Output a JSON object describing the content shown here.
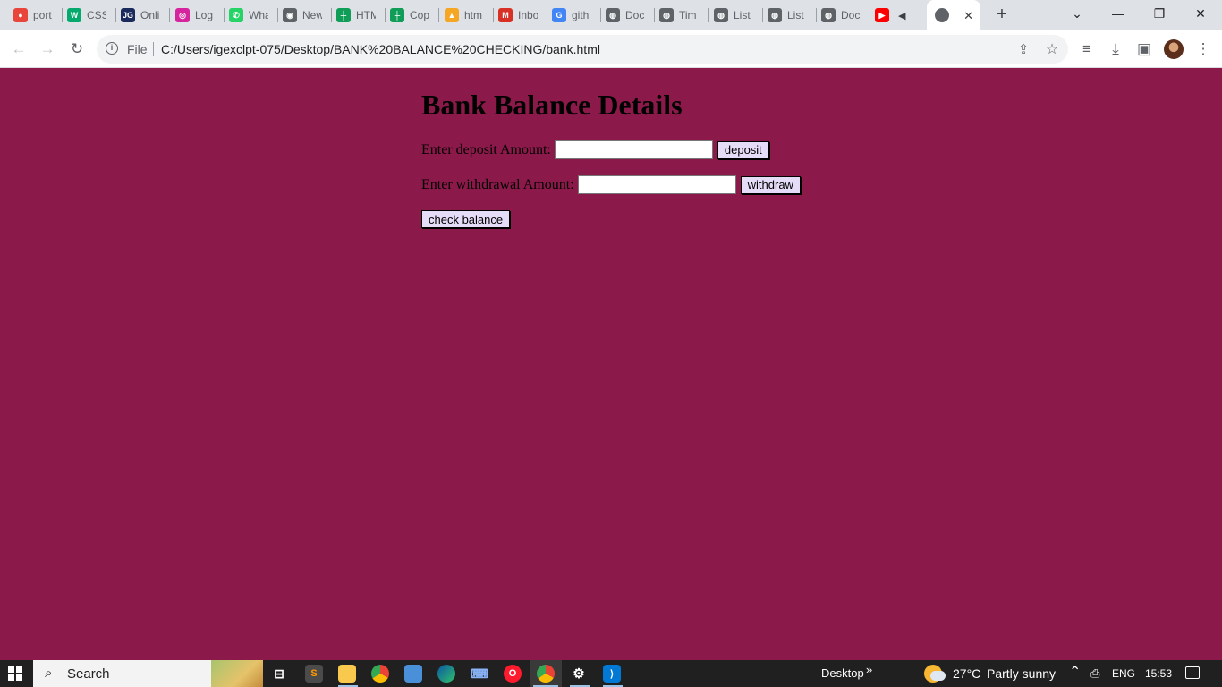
{
  "browser": {
    "tabs": [
      {
        "label": "port",
        "icon": "pdf-icon",
        "color": "#e8453c",
        "glyph": "●"
      },
      {
        "label": "CSS",
        "icon": "w3schools-icon",
        "color": "#04aa6d",
        "glyph": "W"
      },
      {
        "label": "Onli",
        "icon": "jgi-icon",
        "color": "#1b2a5c",
        "glyph": "JG"
      },
      {
        "label": "Log",
        "icon": "instagram-icon",
        "color": "#d6249f",
        "glyph": "◎"
      },
      {
        "label": "Wha",
        "icon": "whatsapp-icon",
        "color": "#25d366",
        "glyph": "✆"
      },
      {
        "label": "New",
        "icon": "chrome-icon",
        "color": "#5f6368",
        "glyph": "◉"
      },
      {
        "label": "HTM",
        "icon": "sheets-icon",
        "color": "#0f9d58",
        "glyph": "┼"
      },
      {
        "label": "Cop",
        "icon": "sheets-icon",
        "color": "#0f9d58",
        "glyph": "┼"
      },
      {
        "label": "htm",
        "icon": "chart-icon",
        "color": "#f5a623",
        "glyph": "▲"
      },
      {
        "label": "Inbo",
        "icon": "gmail-icon",
        "color": "#d93025",
        "glyph": "M"
      },
      {
        "label": "gith",
        "icon": "google-icon",
        "color": "#4285f4",
        "glyph": "G"
      },
      {
        "label": "Doc",
        "icon": "globe-icon",
        "color": "#5f6368",
        "glyph": "◍"
      },
      {
        "label": "Tim",
        "icon": "globe-icon",
        "color": "#5f6368",
        "glyph": "◍"
      },
      {
        "label": "List",
        "icon": "globe-icon",
        "color": "#5f6368",
        "glyph": "◍"
      },
      {
        "label": "List",
        "icon": "globe-icon",
        "color": "#5f6368",
        "glyph": "◍"
      },
      {
        "label": "Doc",
        "icon": "globe-icon",
        "color": "#5f6368",
        "glyph": "◍"
      },
      {
        "label": "",
        "icon": "youtube-icon",
        "color": "#ff0000",
        "glyph": "▶"
      }
    ],
    "active_tab_icon": "globe-icon",
    "omnibox": {
      "scheme": "File",
      "url": "C:/Users/igexclpt-075/Desktop/BANK%20BALANCE%20CHECKING/bank.html"
    }
  },
  "page": {
    "title": "Bank Balance Details",
    "deposit": {
      "label": "Enter deposit Amount:",
      "value": "",
      "button": "deposit"
    },
    "withdraw": {
      "label": "Enter withdrawal Amount:",
      "value": "",
      "button": "withdraw"
    },
    "check_button": "check balance",
    "background": "#8b1a4a",
    "button_color": "#e5dcf7"
  },
  "taskbar": {
    "search_label": "Search",
    "desktop_label": "Desktop",
    "weather_temp": "27°C",
    "weather_text": "Partly sunny",
    "language": "ENG",
    "time": "15:53"
  }
}
